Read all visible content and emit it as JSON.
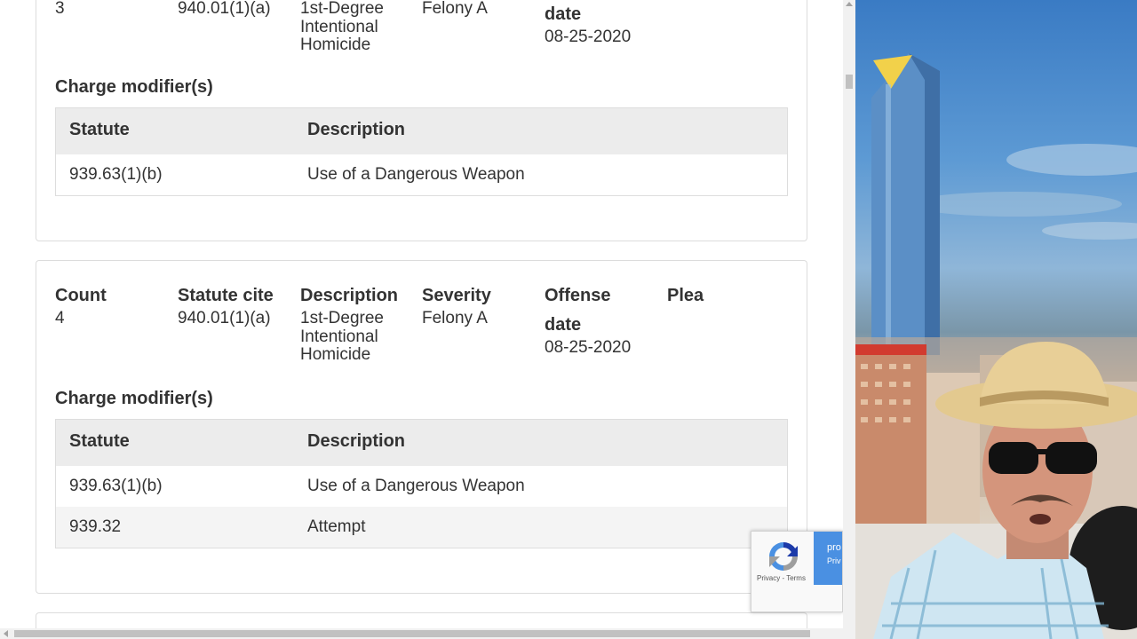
{
  "charges": [
    {
      "count_value": "3",
      "statute_cite": "940.01(1)(a)",
      "description_lines": [
        "1st-Degree",
        "Intentional",
        "Homicide"
      ],
      "severity": "Felony A",
      "offense_date_label": "date",
      "offense_date": "08-25-2020",
      "modifiers_title": "Charge modifier(s)",
      "modifiers_headers": {
        "statute": "Statute",
        "description": "Description"
      },
      "modifiers": [
        {
          "statute": "939.63(1)(b)",
          "description": "Use of a Dangerous Weapon"
        }
      ]
    },
    {
      "headers": {
        "count": "Count",
        "statute_cite": "Statute cite",
        "description": "Description",
        "severity": "Severity",
        "offense_line1": "Offense",
        "offense_line2": "date",
        "plea": "Plea"
      },
      "count_value": "4",
      "statute_cite": "940.01(1)(a)",
      "description_lines": [
        "1st-Degree",
        "Intentional",
        "Homicide"
      ],
      "severity": "Felony A",
      "offense_date": "08-25-2020",
      "modifiers_title": "Charge modifier(s)",
      "modifiers_headers": {
        "statute": "Statute",
        "description": "Description"
      },
      "modifiers": [
        {
          "statute": "939.63(1)(b)",
          "description": "Use of a Dangerous Weapon"
        },
        {
          "statute": "939.32",
          "description": "Attempt"
        }
      ]
    }
  ],
  "recaptcha": {
    "links": "Privacy - Terms",
    "badge_line1": "pro",
    "badge_line2": "Priv"
  },
  "colors": {
    "table_header_bg": "#ececec",
    "alt_row_bg": "#f4f4f4",
    "recaptcha_blue": "#4a90e2"
  }
}
